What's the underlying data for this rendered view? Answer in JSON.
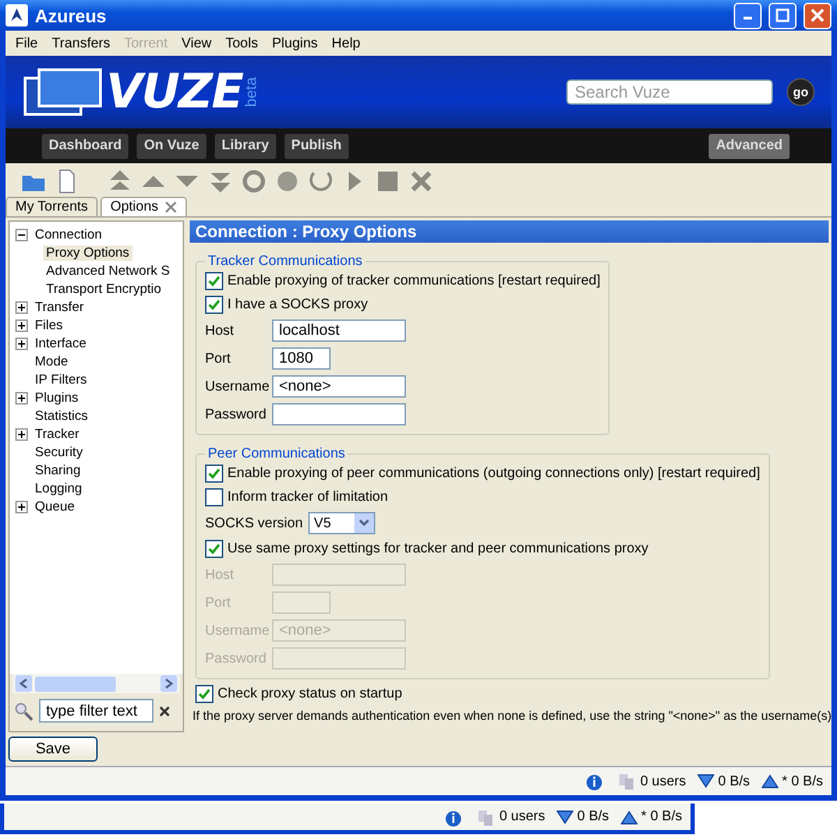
{
  "window": {
    "title": "Azureus"
  },
  "menu": [
    {
      "label": "File",
      "disabled": false
    },
    {
      "label": "Transfers",
      "disabled": false
    },
    {
      "label": "Torrent",
      "disabled": true
    },
    {
      "label": "View",
      "disabled": false
    },
    {
      "label": "Tools",
      "disabled": false
    },
    {
      "label": "Plugins",
      "disabled": false
    },
    {
      "label": "Help",
      "disabled": false
    }
  ],
  "header": {
    "wordmark": "VUZE",
    "tag": "beta",
    "search": {
      "placeholder": "Search Vuze"
    },
    "go": "go"
  },
  "nav": [
    {
      "label": "Dashboard",
      "selected": false
    },
    {
      "label": "On Vuze",
      "selected": false
    },
    {
      "label": "Library",
      "selected": false
    },
    {
      "label": "Publish",
      "selected": false
    },
    {
      "label": "Advanced",
      "selected": true
    }
  ],
  "tabs": [
    {
      "label": "My Torrents",
      "selected": false,
      "closable": false
    },
    {
      "label": "Options",
      "selected": true,
      "closable": true
    }
  ],
  "tree": [
    {
      "label": "Connection",
      "expanded": true,
      "selected": false,
      "children": [
        {
          "label": "Proxy Options",
          "selected": true
        },
        {
          "label": "Advanced Network S",
          "selected": false
        },
        {
          "label": "Transport Encryptio",
          "selected": false
        }
      ]
    },
    {
      "label": "Transfer",
      "expanded": false,
      "selected": false
    },
    {
      "label": "Files",
      "expanded": false,
      "selected": false
    },
    {
      "label": "Interface",
      "expanded": false,
      "selected": false
    },
    {
      "label": "Mode",
      "selected": false
    },
    {
      "label": "IP Filters",
      "selected": false
    },
    {
      "label": "Plugins",
      "expanded": false,
      "selected": false
    },
    {
      "label": "Statistics",
      "selected": false
    },
    {
      "label": "Tracker",
      "expanded": false,
      "selected": false
    },
    {
      "label": "Security",
      "selected": false
    },
    {
      "label": "Sharing",
      "selected": false
    },
    {
      "label": "Logging",
      "selected": false
    },
    {
      "label": "Queue",
      "expanded": false,
      "selected": false
    }
  ],
  "filter": {
    "placeholder": "type filter text"
  },
  "panel": {
    "title": "Connection : Proxy Options",
    "groups": [
      {
        "title": "Tracker Communications",
        "rows": [
          {
            "kind": "checkbox",
            "label": "Enable proxying of tracker communications [restart required]",
            "checked": true,
            "disabled": false
          },
          {
            "kind": "checkbox",
            "label": "I have a SOCKS proxy",
            "checked": true,
            "disabled": false
          },
          {
            "kind": "text",
            "label": "Host",
            "value": "localhost",
            "disabled": false
          },
          {
            "kind": "number",
            "label": "Port",
            "value": "1080",
            "disabled": false
          },
          {
            "kind": "text",
            "label": "Username",
            "value": "<none>",
            "disabled": false
          },
          {
            "kind": "text",
            "label": "Password",
            "disabled": false
          }
        ]
      },
      {
        "title": "Peer Communications",
        "rows": [
          {
            "kind": "checkbox",
            "label": "Enable proxying of peer communications (outgoing connections only) [restart required]",
            "checked": true,
            "disabled": false
          },
          {
            "kind": "checkbox",
            "label": "Inform tracker of limitation",
            "checked": false,
            "disabled": false
          },
          {
            "kind": "select",
            "label": "SOCKS version",
            "value": "V5",
            "disabled": false
          },
          {
            "kind": "checkbox",
            "label": "Use same proxy settings for tracker and peer communications proxy",
            "checked": true,
            "disabled": false
          },
          {
            "kind": "text",
            "label": "Host",
            "disabled": true
          },
          {
            "kind": "number",
            "label": "Port",
            "disabled": true
          },
          {
            "kind": "text",
            "label": "Username",
            "value": "<none>",
            "disabled": true
          },
          {
            "kind": "text",
            "label": "Password",
            "disabled": true
          }
        ]
      }
    ],
    "startup_check": {
      "label": "Check proxy status on startup",
      "checked": true
    },
    "note": "If the proxy server demands authentication even when none is defined, use the string \"<none>\" as the username(s)"
  },
  "save": "Save",
  "status_bars": [
    {
      "users": "0 users",
      "down": "0 B/s",
      "up": "* 0 B/s"
    },
    {
      "users": "0 users",
      "down": "0 B/s",
      "up": "* 0 B/s"
    }
  ]
}
